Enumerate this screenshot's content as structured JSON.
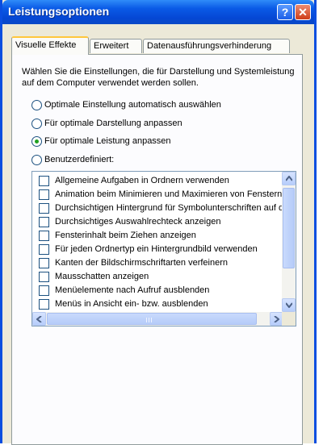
{
  "window": {
    "title": "Leistungsoptionen",
    "help_glyph": "?",
    "close_glyph": "✕"
  },
  "tabs": [
    {
      "label": "Visuelle Effekte",
      "active": true
    },
    {
      "label": "Erweitert",
      "active": false
    },
    {
      "label": "Datenausführungsverhinderung",
      "active": false
    }
  ],
  "description": "Wählen Sie die Einstellungen, die für Darstellung und Systemleistung auf dem Computer verwendet werden sollen.",
  "radio_options": [
    {
      "label": "Optimale Einstellung automatisch auswählen",
      "checked": false
    },
    {
      "label": "Für optimale Darstellung anpassen",
      "checked": false
    },
    {
      "label": "Für optimale Leistung anpassen",
      "checked": true
    },
    {
      "label": "Benutzerdefiniert:",
      "checked": false
    }
  ],
  "effects_list": [
    {
      "label": "Allgemeine Aufgaben in Ordnern verwenden",
      "checked": false
    },
    {
      "label": "Animation beim Minimieren und Maximieren von Fenstern",
      "checked": false
    },
    {
      "label": "Durchsichtigen Hintergrund für Symbolunterschriften auf d",
      "checked": false
    },
    {
      "label": "Durchsichtiges Auswahlrechteck anzeigen",
      "checked": false
    },
    {
      "label": "Fensterinhalt beim Ziehen anzeigen",
      "checked": false
    },
    {
      "label": "Für jeden Ordnertyp ein Hintergrundbild verwenden",
      "checked": false
    },
    {
      "label": "Kanten der Bildschirmschriftarten verfeinern",
      "checked": false
    },
    {
      "label": "Mausschatten anzeigen",
      "checked": false
    },
    {
      "label": "Menüelemente nach Aufruf ausblenden",
      "checked": false
    },
    {
      "label": "Menüs in Ansicht ein- bzw. ausblenden",
      "checked": false
    }
  ],
  "colors": {
    "titlebar": "#0a5ae6",
    "active_tab_highlight": "#ffc73c",
    "radio_dot": "#21a121",
    "dialog_face": "#ece9d8"
  }
}
